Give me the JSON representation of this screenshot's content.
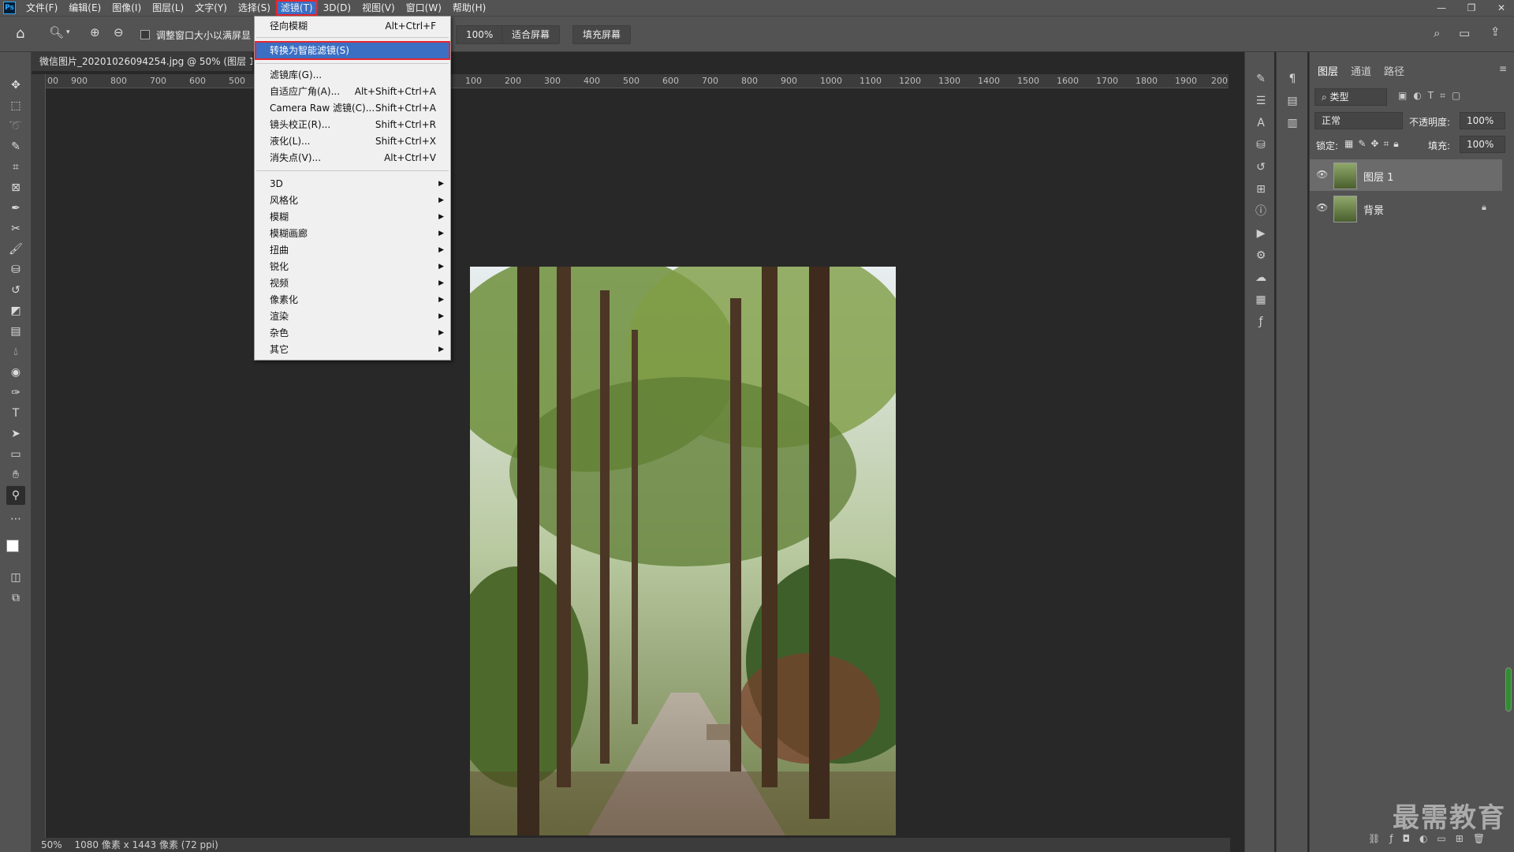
{
  "app": {
    "logo": "Ps"
  },
  "menubar": {
    "items": [
      "文件(F)",
      "编辑(E)",
      "图像(I)",
      "图层(L)",
      "文字(Y)",
      "选择(S)",
      "滤镜(T)",
      "3D(D)",
      "视图(V)",
      "窗口(W)",
      "帮助(H)"
    ],
    "active_index": 6
  },
  "window_controls": {
    "minimize": "—",
    "restore": "❐",
    "close": "✕"
  },
  "options_bar": {
    "checkbox_label": "调整窗口大小以满屏显",
    "zoom_value": "100%",
    "fit_screen": "适合屏幕",
    "fill_screen": "填充屏幕"
  },
  "document": {
    "tab_title": "微信图片_20201026094254.jpg @ 50% (图层 1,",
    "status_zoom": "50%",
    "status_info": "1080 像素 x 1443 像素 (72 ppi)"
  },
  "ruler": {
    "h_ticks": [
      "00",
      "900",
      "800",
      "700",
      "600",
      "500",
      "100",
      "200",
      "300",
      "400",
      "500",
      "600",
      "700",
      "800",
      "900",
      "1000",
      "1100",
      "1200",
      "1300",
      "1400",
      "1500",
      "1600",
      "1700",
      "1800",
      "1900",
      "200"
    ]
  },
  "filter_menu": {
    "items": [
      {
        "label": "径向模糊",
        "shortcut": "Alt+Ctrl+F"
      },
      {
        "label": "转换为智能滤镜(S)",
        "shortcut": "",
        "highlighted": true
      },
      {
        "label": "滤镜库(G)...",
        "shortcut": ""
      },
      {
        "label": "自适应广角(A)...",
        "shortcut": "Alt+Shift+Ctrl+A"
      },
      {
        "label": "Camera Raw 滤镜(C)...",
        "shortcut": "Shift+Ctrl+A"
      },
      {
        "label": "镜头校正(R)...",
        "shortcut": "Shift+Ctrl+R"
      },
      {
        "label": "液化(L)...",
        "shortcut": "Shift+Ctrl+X"
      },
      {
        "label": "消失点(V)...",
        "shortcut": "Alt+Ctrl+V"
      },
      {
        "label": "3D",
        "submenu": true
      },
      {
        "label": "风格化",
        "submenu": true
      },
      {
        "label": "模糊",
        "submenu": true
      },
      {
        "label": "模糊画廊",
        "submenu": true
      },
      {
        "label": "扭曲",
        "submenu": true
      },
      {
        "label": "锐化",
        "submenu": true
      },
      {
        "label": "视频",
        "submenu": true
      },
      {
        "label": "像素化",
        "submenu": true
      },
      {
        "label": "渲染",
        "submenu": true
      },
      {
        "label": "杂色",
        "submenu": true
      },
      {
        "label": "其它",
        "submenu": true
      }
    ]
  },
  "layers_panel": {
    "tabs": [
      "图层",
      "通道",
      "路径"
    ],
    "filter_kind": "类型",
    "blend_mode": "正常",
    "opacity_label": "不透明度:",
    "opacity_value": "100%",
    "lock_label": "锁定:",
    "fill_label": "填充:",
    "fill_value": "100%",
    "layers": [
      {
        "name": "图层 1",
        "selected": true,
        "locked": false
      },
      {
        "name": "背景",
        "selected": false,
        "locked": true
      }
    ]
  },
  "watermark": "最需教育",
  "colors": {
    "accent": "#3a6fc4",
    "highlight_border": "#e8262e",
    "panel": "#535353",
    "canvas": "#282828"
  }
}
